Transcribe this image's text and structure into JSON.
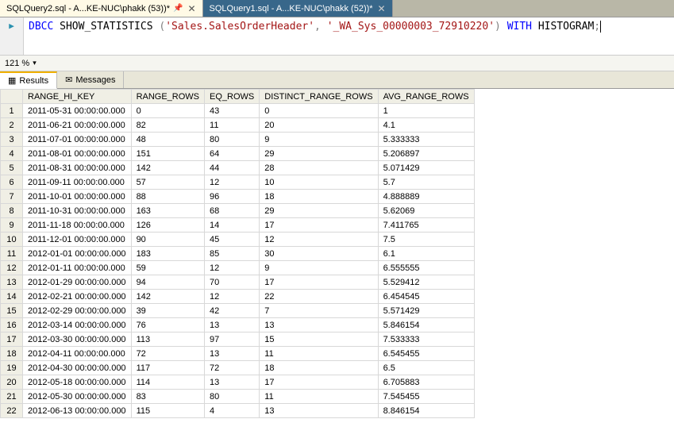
{
  "tabs": [
    {
      "label": "SQLQuery2.sql - A...KE-NUC\\phakk (53))*",
      "active": true,
      "pinned": true
    },
    {
      "label": "SQLQuery1.sql - A...KE-NUC\\phakk (52))*",
      "active": false,
      "pinned": false
    }
  ],
  "editor": {
    "lineNumber": "",
    "tokens": [
      {
        "t": "DBCC",
        "c": "kw-blue"
      },
      {
        "t": " SHOW_STATISTICS ",
        "c": ""
      },
      {
        "t": "(",
        "c": "kw-gray"
      },
      {
        "t": "'Sales.SalesOrderHeader'",
        "c": "kw-red"
      },
      {
        "t": ",",
        "c": "kw-gray"
      },
      {
        "t": " ",
        "c": ""
      },
      {
        "t": "'_WA_Sys_00000003_72910220'",
        "c": "kw-red"
      },
      {
        "t": ")",
        "c": "kw-gray"
      },
      {
        "t": " ",
        "c": ""
      },
      {
        "t": "WITH",
        "c": "kw-blue"
      },
      {
        "t": " HISTOGRAM",
        "c": ""
      },
      {
        "t": ";",
        "c": "kw-gray"
      }
    ]
  },
  "zoom": {
    "value": "121 %"
  },
  "panelTabs": [
    {
      "label": "Results",
      "icon": "▦",
      "active": true
    },
    {
      "label": "Messages",
      "icon": "✉",
      "active": false
    }
  ],
  "grid": {
    "columns": [
      "RANGE_HI_KEY",
      "RANGE_ROWS",
      "EQ_ROWS",
      "DISTINCT_RANGE_ROWS",
      "AVG_RANGE_ROWS"
    ],
    "rows": [
      [
        "2011-05-31 00:00:00.000",
        "0",
        "43",
        "0",
        "1"
      ],
      [
        "2011-06-21 00:00:00.000",
        "82",
        "11",
        "20",
        "4.1"
      ],
      [
        "2011-07-01 00:00:00.000",
        "48",
        "80",
        "9",
        "5.333333"
      ],
      [
        "2011-08-01 00:00:00.000",
        "151",
        "64",
        "29",
        "5.206897"
      ],
      [
        "2011-08-31 00:00:00.000",
        "142",
        "44",
        "28",
        "5.071429"
      ],
      [
        "2011-09-11 00:00:00.000",
        "57",
        "12",
        "10",
        "5.7"
      ],
      [
        "2011-10-01 00:00:00.000",
        "88",
        "96",
        "18",
        "4.888889"
      ],
      [
        "2011-10-31 00:00:00.000",
        "163",
        "68",
        "29",
        "5.62069"
      ],
      [
        "2011-11-18 00:00:00.000",
        "126",
        "14",
        "17",
        "7.411765"
      ],
      [
        "2011-12-01 00:00:00.000",
        "90",
        "45",
        "12",
        "7.5"
      ],
      [
        "2012-01-01 00:00:00.000",
        "183",
        "85",
        "30",
        "6.1"
      ],
      [
        "2012-01-11 00:00:00.000",
        "59",
        "12",
        "9",
        "6.555555"
      ],
      [
        "2012-01-29 00:00:00.000",
        "94",
        "70",
        "17",
        "5.529412"
      ],
      [
        "2012-02-21 00:00:00.000",
        "142",
        "12",
        "22",
        "6.454545"
      ],
      [
        "2012-02-29 00:00:00.000",
        "39",
        "42",
        "7",
        "5.571429"
      ],
      [
        "2012-03-14 00:00:00.000",
        "76",
        "13",
        "13",
        "5.846154"
      ],
      [
        "2012-03-30 00:00:00.000",
        "113",
        "97",
        "15",
        "7.533333"
      ],
      [
        "2012-04-11 00:00:00.000",
        "72",
        "13",
        "11",
        "6.545455"
      ],
      [
        "2012-04-30 00:00:00.000",
        "117",
        "72",
        "18",
        "6.5"
      ],
      [
        "2012-05-18 00:00:00.000",
        "114",
        "13",
        "17",
        "6.705883"
      ],
      [
        "2012-05-30 00:00:00.000",
        "83",
        "80",
        "11",
        "7.545455"
      ],
      [
        "2012-06-13 00:00:00.000",
        "115",
        "4",
        "13",
        "8.846154"
      ]
    ]
  }
}
